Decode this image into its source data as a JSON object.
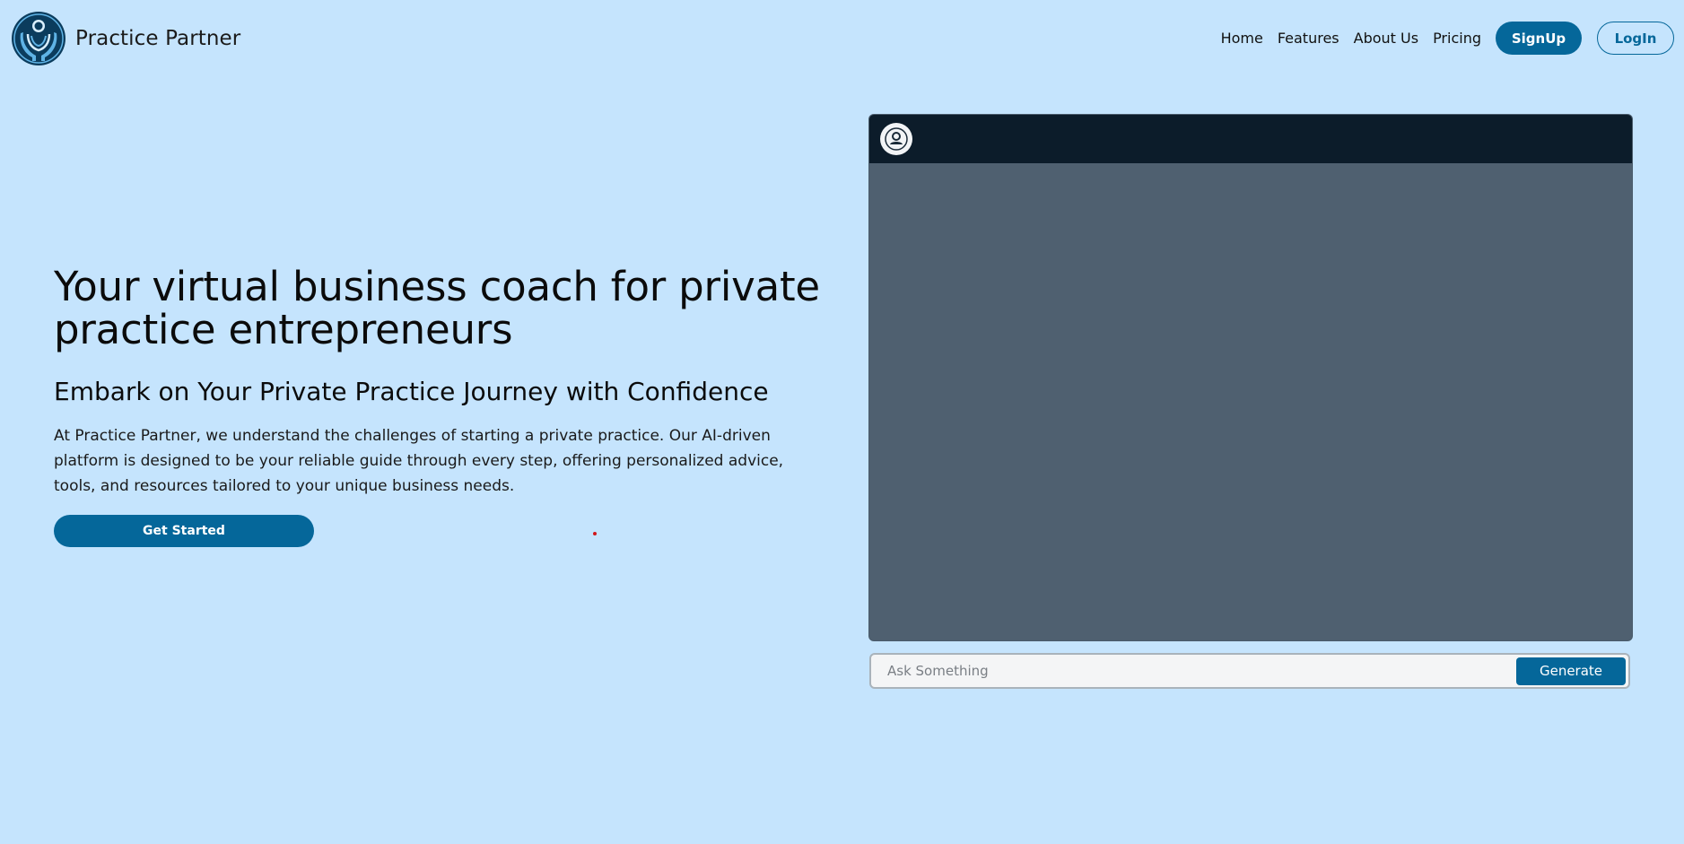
{
  "brand": {
    "name": "Practice Partner",
    "logo_icon": "hands-holding-person-logo"
  },
  "nav": {
    "links": [
      "Home",
      "Features",
      "About Us",
      "Pricing"
    ],
    "signup_label": "SignUp",
    "login_label": "LogIn"
  },
  "hero": {
    "title": "Your virtual business coach for private practice entrepreneurs",
    "subtitle": "Embark on Your Private Practice Journey with Confidence",
    "description": "At Practice Partner, we understand the challenges of starting a private practice. Our AI-driven platform is designed to be your reliable guide through every step, offering personalized advice, tools, and resources tailored to your unique business needs.",
    "cta_label": "Get Started"
  },
  "chat": {
    "avatar_icon": "user-icon",
    "input_placeholder": "Ask Something",
    "input_value": "",
    "generate_label": "Generate"
  },
  "colors": {
    "background": "#c5e4fd",
    "primary": "#05679a",
    "chat_header": "#0c1c2a",
    "chat_body": "#4f6070"
  }
}
